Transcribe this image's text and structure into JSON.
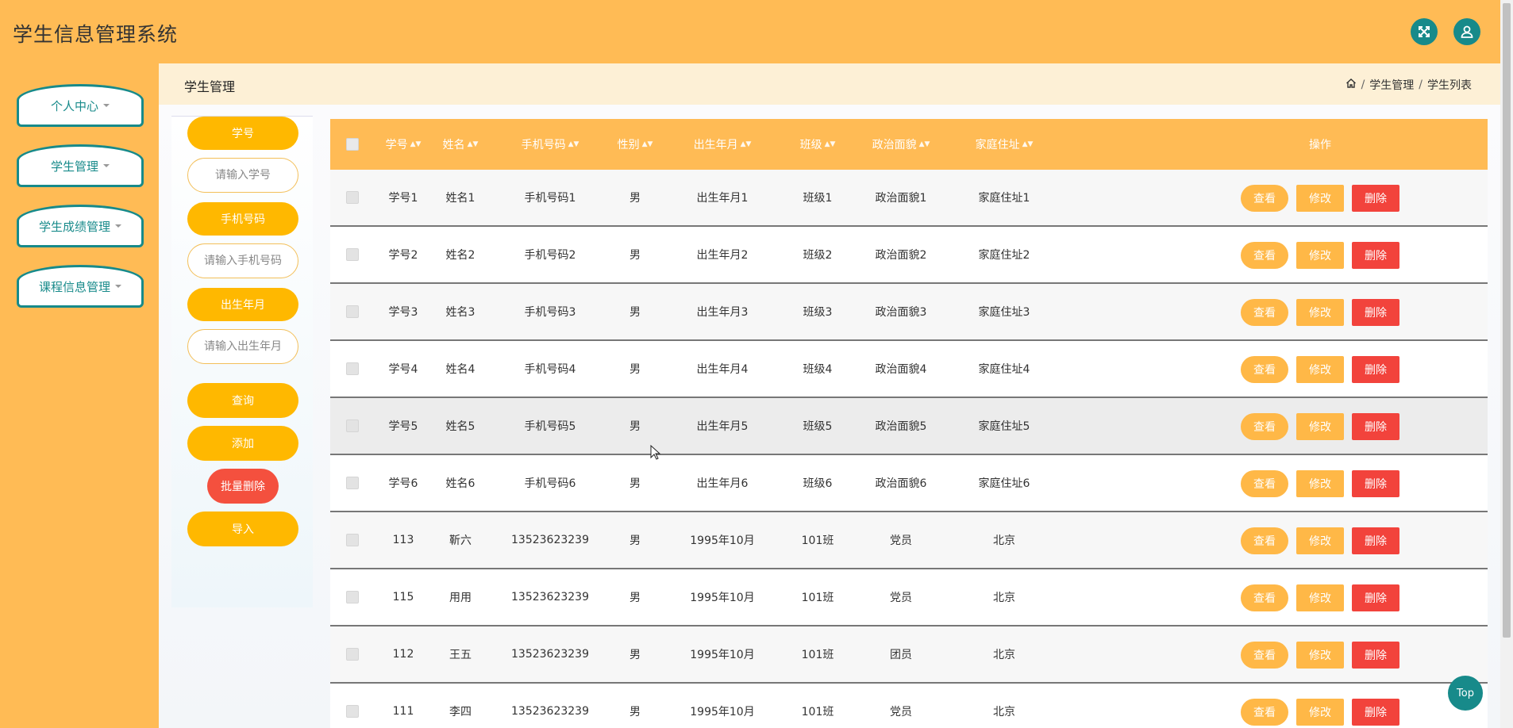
{
  "header": {
    "title": "学生信息管理系统",
    "expand_icon": "expand-icon",
    "user_icon": "user-icon",
    "accent": "#178a8a",
    "bg": "#ffbb55"
  },
  "sidebar": {
    "items": [
      {
        "label": "个人中心"
      },
      {
        "label": "学生管理"
      },
      {
        "label": "学生成绩管理"
      },
      {
        "label": "课程信息管理"
      }
    ]
  },
  "breadcrumb": {
    "title": "学生管理",
    "home_icon": "home-icon",
    "crumbs": [
      "学生管理",
      "学生列表"
    ],
    "separator": "/"
  },
  "search": {
    "fields": [
      {
        "label": "学号",
        "placeholder": "请输入学号"
      },
      {
        "label": "手机号码",
        "placeholder": "请输入手机号码"
      },
      {
        "label": "出生年月",
        "placeholder": "请输入出生年月"
      }
    ],
    "buttons": {
      "query": "查询",
      "add": "添加",
      "batch_delete": "批量删除",
      "import": "导入"
    }
  },
  "table": {
    "headers": [
      "学号",
      "姓名",
      "手机号码",
      "性别",
      "出生年月",
      "班级",
      "政治面貌",
      "家庭住址",
      "操作"
    ],
    "actions": {
      "view": "查看",
      "edit": "修改",
      "delete": "删除"
    },
    "rows": [
      [
        "学号1",
        "姓名1",
        "手机号码1",
        "男",
        "出生年月1",
        "班级1",
        "政治面貌1",
        "家庭住址1"
      ],
      [
        "学号2",
        "姓名2",
        "手机号码2",
        "男",
        "出生年月2",
        "班级2",
        "政治面貌2",
        "家庭住址2"
      ],
      [
        "学号3",
        "姓名3",
        "手机号码3",
        "男",
        "出生年月3",
        "班级3",
        "政治面貌3",
        "家庭住址3"
      ],
      [
        "学号4",
        "姓名4",
        "手机号码4",
        "男",
        "出生年月4",
        "班级4",
        "政治面貌4",
        "家庭住址4"
      ],
      [
        "学号5",
        "姓名5",
        "手机号码5",
        "男",
        "出生年月5",
        "班级5",
        "政治面貌5",
        "家庭住址5"
      ],
      [
        "学号6",
        "姓名6",
        "手机号码6",
        "男",
        "出生年月6",
        "班级6",
        "政治面貌6",
        "家庭住址6"
      ],
      [
        "113",
        "靳六",
        "13523623239",
        "男",
        "1995年10月",
        "101班",
        "党员",
        "北京"
      ],
      [
        "115",
        "用用",
        "13523623239",
        "男",
        "1995年10月",
        "101班",
        "党员",
        "北京"
      ],
      [
        "112",
        "王五",
        "13523623239",
        "男",
        "1995年10月",
        "101班",
        "团员",
        "北京"
      ],
      [
        "111",
        "李四",
        "13523623239",
        "男",
        "1995年10月",
        "101班",
        "党员",
        "北京"
      ]
    ]
  },
  "top_button": "Top"
}
